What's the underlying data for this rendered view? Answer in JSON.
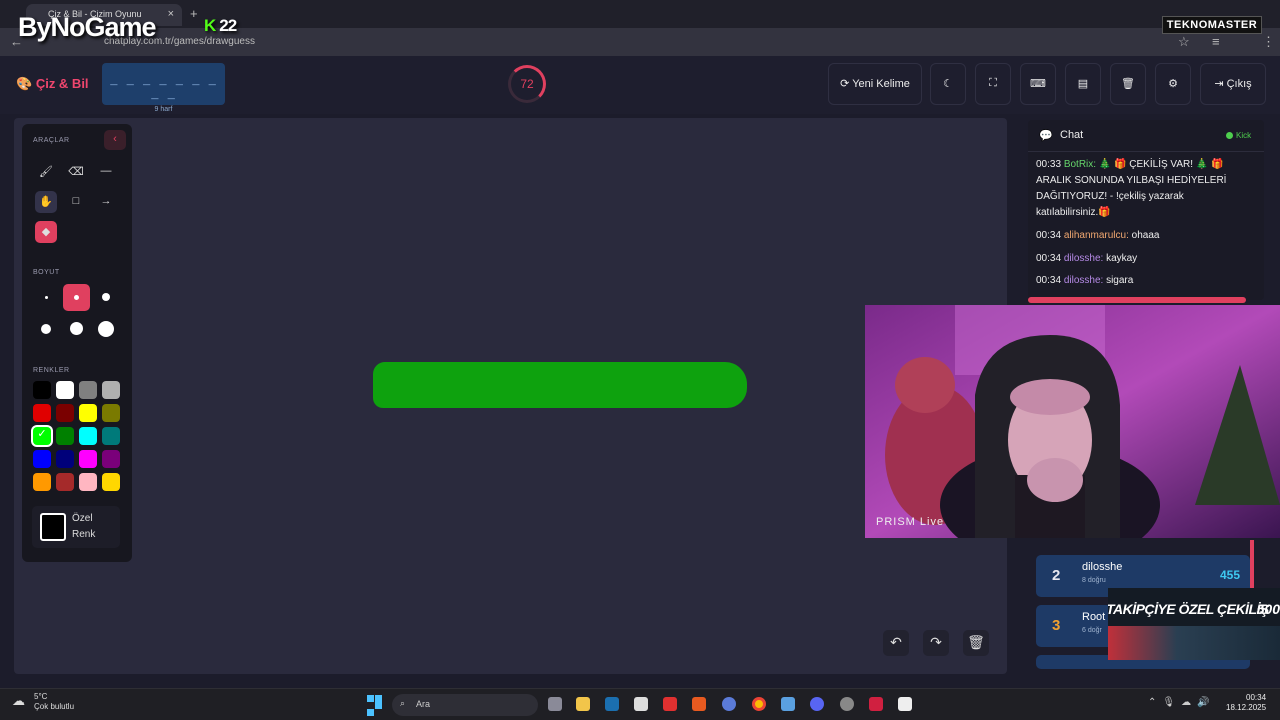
{
  "browser": {
    "tab_title": "Çiz & Bil - Çizim Oyunu",
    "url": "chatplay.com.tr/games/drawguess",
    "overlay_logo": "ByNoGame",
    "kick_count": "22",
    "sponsor": "TEKNOMASTER"
  },
  "header": {
    "brand": "Çiz & Bil",
    "word_blanks": "_ _ _ _ _ _ _ _ _",
    "word_hint": "9 harf",
    "timer": "72",
    "buttons": {
      "new_word": "Yeni Kelime",
      "exit": "Çıkış"
    }
  },
  "tools": {
    "section_tools": "ARAÇLAR",
    "section_size": "BOYUT",
    "section_colors": "RENKLER",
    "custom_color": "Özel Renk",
    "custom_line1": "Özel",
    "custom_line2": "Renk",
    "colors": [
      "#000000",
      "#ffffff",
      "#808080",
      "#b0b0b0",
      "#e00000",
      "#7a0000",
      "#ffff00",
      "#7a7a00",
      "#00ff00",
      "#008000",
      "#00ffff",
      "#007a7a",
      "#0000ff",
      "#00007a",
      "#ff00ff",
      "#7a007a",
      "#ff9900",
      "#a52a2a",
      "#ffb6c1",
      "#ffd700"
    ],
    "selected_color": "#00ff00"
  },
  "chat": {
    "title": "Chat",
    "platform": "Kick",
    "messages": [
      {
        "time": "00:33",
        "user": "BotRix:",
        "text": "🎄 🎁 ÇEKİLİŞ VAR! 🎄 🎁 ARALIK SONUNDA YILBAŞI HEDİYELERİ DAĞITIYORUZ! - !çekiliş yazarak katılabilirsiniz.🎁"
      },
      {
        "time": "00:34",
        "user": "alihanmarulcu:",
        "text": "ohaaa"
      },
      {
        "time": "00:34",
        "user": "dilosshe:",
        "text": "kaykay"
      },
      {
        "time": "00:34",
        "user": "dilosshe:",
        "text": "sigara"
      }
    ]
  },
  "webcam": {
    "watermark": "PRISM Live"
  },
  "leaderboard": [
    {
      "rank": "2",
      "name": "dilosshe",
      "detail": "8 doğru",
      "score": "455"
    },
    {
      "rank": "3",
      "name": "Root",
      "detail": "6 doğr",
      "score": ""
    }
  ],
  "promo": {
    "text": "TAKİPÇİYE ÖZEL ÇEKİLİŞ",
    "amount": "500"
  },
  "taskbar": {
    "temp": "5°C",
    "weather": "Çok bulutlu",
    "search": "Ara",
    "time": "00:34",
    "date": "18.12.2025"
  }
}
